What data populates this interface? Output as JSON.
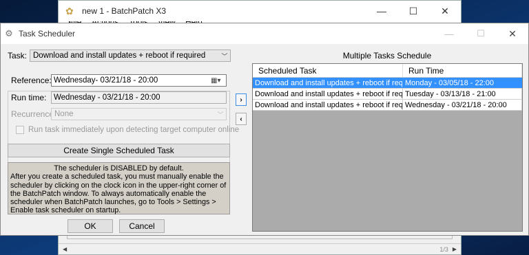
{
  "background_window": {
    "title": "new 1 - BatchPatch X3",
    "menu": [
      "File",
      "Actions",
      "Tools",
      "View",
      "Help"
    ],
    "page_indicator": "1/3"
  },
  "dialog": {
    "title": "Task Scheduler",
    "task_label": "Task:",
    "task_value": "Download and install updates + reboot if required",
    "reference_label": "Reference:",
    "reference_value": "Wednesday- 03/21/18 - 20:00",
    "runtime_label": "Run time:",
    "runtime_value": "Wednesday - 03/21/18 - 20:00",
    "recurrence_label": "Recurrence:",
    "recurrence_value": "None",
    "immediate_label": "Run task immediately upon detecting target computer online",
    "create_button": "Create Single Scheduled Task",
    "info_heading": "The scheduler is DISABLED by default.",
    "info_body": "After you create a scheduled task, you must manually enable the scheduler by clicking on the clock icon in the upper-right corner of the BatchPatch window.  To always automatically enable the scheduler when BatchPatch launches, go to Tools > Settings > Enable task scheduler on startup.",
    "ok_button": "OK",
    "cancel_button": "Cancel",
    "add_arrow": "›",
    "remove_arrow": "‹",
    "schedule_title": "Multiple Tasks Schedule",
    "columns": [
      "Scheduled Task",
      "Run Time"
    ],
    "rows": [
      {
        "task": "Download and install updates + reboot if required",
        "time": "Monday - 03/05/18 - 22:00",
        "selected": true
      },
      {
        "task": "Download and install updates + reboot if required",
        "time": "Tuesday - 03/13/18 - 21:00",
        "selected": false
      },
      {
        "task": "Download and install updates + reboot if required",
        "time": "Wednesday - 03/21/18 - 20:00",
        "selected": false
      }
    ]
  },
  "colors": {
    "selection": "#3390ff",
    "grid_empty": "#ababab",
    "info_bg": "#d4d0c8"
  }
}
